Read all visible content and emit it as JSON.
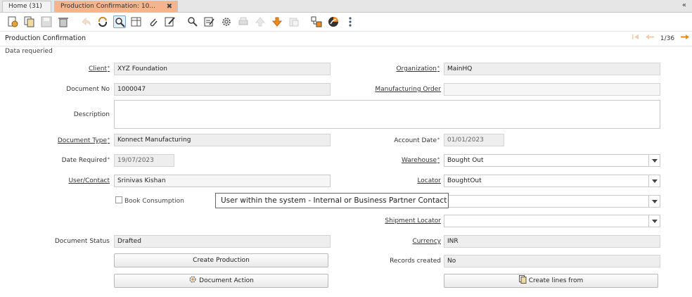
{
  "tabs": [
    {
      "label": "Home (31)"
    },
    {
      "label": "Production Confirmation: 10...",
      "close": "✖"
    }
  ],
  "collapse_glyph": "«",
  "toolbar_icons": [
    "new-record-icon",
    "copy-record-icon",
    "save-icon",
    "delete-icon",
    "undo-icon",
    "refresh-icon",
    "find-icon",
    "grid-toggle-icon",
    "attachment-icon",
    "note-icon",
    "zoom-across-icon",
    "report-icon",
    "process-gear-icon",
    "print-icon",
    "parent-up-icon",
    "detail-down-icon",
    "archive-icon",
    "workflow-icon",
    "chat-icon",
    "more-icon"
  ],
  "window": {
    "title": "Production Confirmation",
    "record_position": "1/36",
    "status": "Data requeried"
  },
  "form": {
    "client": {
      "label": "Client",
      "value": "XYZ Foundation"
    },
    "organization": {
      "label": "Organization",
      "value": "MainHQ"
    },
    "document_no": {
      "label": "Document No",
      "value": "1000047"
    },
    "manufacturing_order": {
      "label": "Manufacturing Order",
      "value": ""
    },
    "description": {
      "label": "Description",
      "value": ""
    },
    "document_type": {
      "label": "Document Type",
      "value": "Konnect Manufacturing"
    },
    "account_date": {
      "label": "Account Date",
      "value": "01/01/2023"
    },
    "date_required": {
      "label": "Date Required",
      "value": "19/07/2023"
    },
    "warehouse": {
      "label": "Warehouse",
      "value": "Bought Out"
    },
    "user_contact": {
      "label": "User/Contact",
      "value": "Srinivas Kishan"
    },
    "locator": {
      "label": "Locator",
      "value": "BoughtOut"
    },
    "book_consumption": {
      "label": "Book Consumption",
      "checked": false
    },
    "shipment_locator": {
      "label": "Shipment Locator",
      "value": ""
    },
    "document_status": {
      "label": "Document Status",
      "value": "Drafted"
    },
    "currency": {
      "label": "Currency",
      "value": "INR"
    },
    "records_created": {
      "label": "Records created",
      "value": "No"
    }
  },
  "buttons": {
    "create_production": "Create Production",
    "document_action": "Document Action",
    "create_lines_from": "Create lines from"
  },
  "tooltip": "User within the system - Internal or Business Partner Contact",
  "colors": {
    "active_tab": "#f6b48a",
    "field_bg": "#eeeeee",
    "accent_orange": "#f08a1c"
  }
}
